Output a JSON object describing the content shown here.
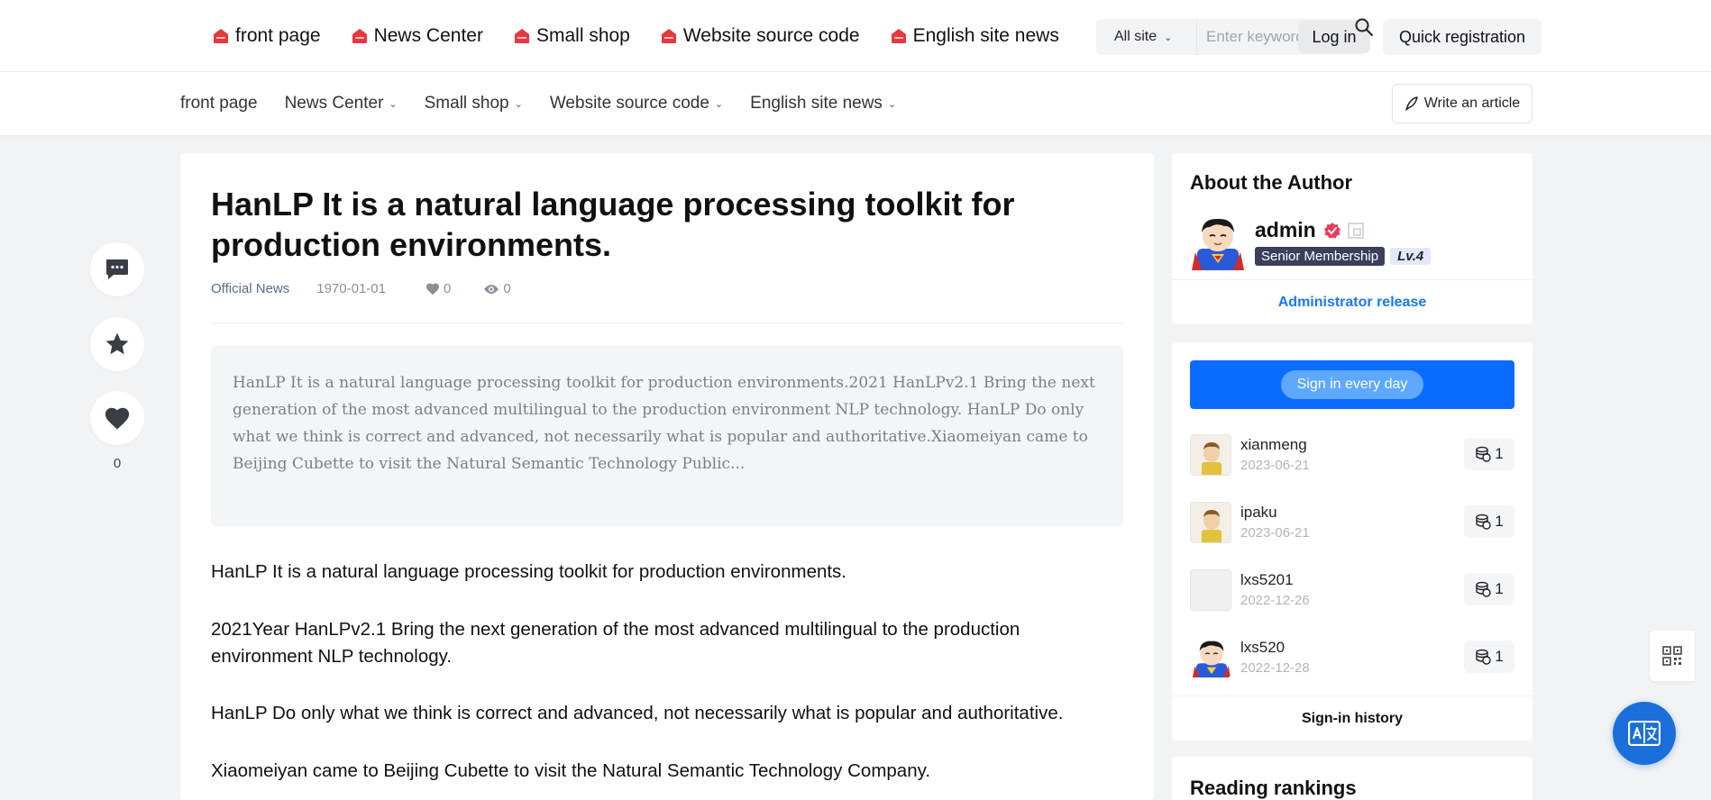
{
  "topnav": {
    "items": [
      "front page",
      "News Center",
      "Small shop",
      "Website source code",
      "English site news"
    ]
  },
  "search": {
    "scope": "All site",
    "placeholder": "Enter keywords"
  },
  "auth": {
    "login": "Log in",
    "register": "Quick registration"
  },
  "subnav": {
    "items": [
      "front page",
      "News Center",
      "Small shop",
      "Website source code",
      "English site news"
    ],
    "write": "Write an article"
  },
  "actions": {
    "like_count": "0"
  },
  "article": {
    "title": "HanLP It is a natural language processing toolkit for production environments.",
    "category": "Official News",
    "date": "1970-01-01",
    "likes": "0",
    "views": "0",
    "summary": "HanLP It is a natural language processing toolkit for production environments.2021 HanLPv2.1 Bring the next generation of the most advanced multilingual to the production environment NLP technology. HanLP Do only what we think is correct and advanced, not necessarily what is popular and authoritative.Xiaomeiyan came to Beijing Cubette to visit the Natural Semantic Technology Public...",
    "paragraphs": [
      "HanLP It is a natural language processing toolkit for production environments.",
      "2021Year HanLPv2.1 Bring the next generation of the most advanced multilingual to the production environment NLP technology.",
      "HanLP Do only what we think is correct and advanced, not necessarily what is popular and authoritative.",
      "Xiaomeiyan came to Beijing Cubette to visit the Natural Semantic Technology Company."
    ]
  },
  "author": {
    "heading": "About the Author",
    "name": "admin",
    "membership": "Senior Membership",
    "level": "Lv.4",
    "release": "Administrator release"
  },
  "signin": {
    "button": "Sign in every day",
    "history": "Sign-in history",
    "list": [
      {
        "name": "xianmeng",
        "date": "2023-06-21",
        "coins": "1"
      },
      {
        "name": "ipaku",
        "date": "2023-06-21",
        "coins": "1"
      },
      {
        "name": "lxs5201",
        "date": "2022-12-26",
        "coins": "1"
      },
      {
        "name": "lxs520",
        "date": "2022-12-28",
        "coins": "1"
      }
    ]
  },
  "rankings": {
    "heading": "Reading rankings"
  },
  "colors": {
    "accent": "#0a6cff",
    "link": "#1677ff",
    "house_icon": "#e8373e",
    "translate": "#1a6fdb"
  }
}
